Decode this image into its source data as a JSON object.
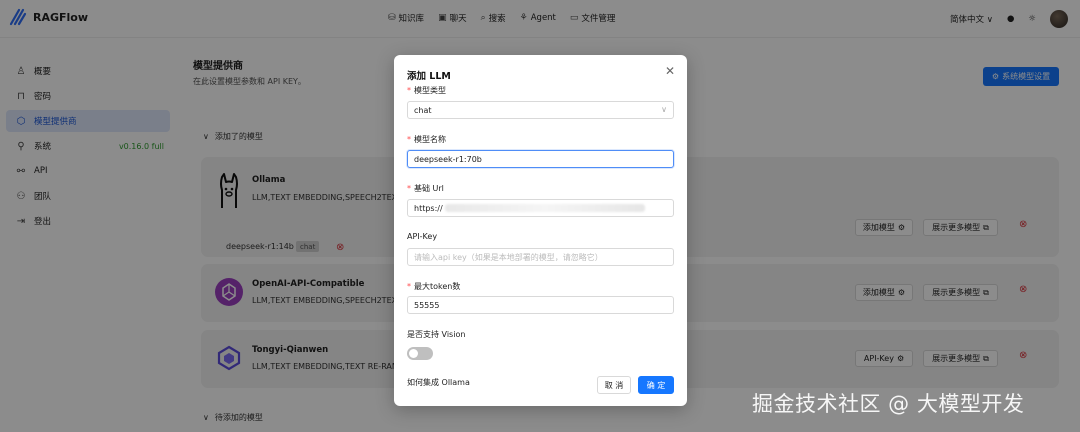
{
  "header": {
    "app_name": "RAGFlow",
    "nav": [
      {
        "icon": "database-icon",
        "label": "知识库"
      },
      {
        "icon": "chat-icon",
        "label": "聊天"
      },
      {
        "icon": "search-icon",
        "label": "搜索"
      },
      {
        "icon": "agent-icon",
        "label": "Agent"
      },
      {
        "icon": "folder-icon",
        "label": "文件管理"
      }
    ],
    "language": "简体中文"
  },
  "sidebar": {
    "items": [
      {
        "icon": "user-icon",
        "label": "概要"
      },
      {
        "icon": "lock-icon",
        "label": "密码"
      },
      {
        "icon": "cube-icon",
        "label": "模型提供商",
        "active": true
      },
      {
        "icon": "system-icon",
        "label": "系统",
        "badge": "v0.16.0 full"
      },
      {
        "icon": "api-icon",
        "label": "API"
      },
      {
        "icon": "team-icon",
        "label": "团队"
      },
      {
        "icon": "logout-icon",
        "label": "登出"
      }
    ]
  },
  "main": {
    "title": "模型提供商",
    "subtitle": "在此设置模型参数和 API KEY。",
    "system_settings_button": "系统模型设置",
    "added_section": "添加了的模型",
    "pending_section": "待添加的模型",
    "cards": [
      {
        "name": "Ollama",
        "tags": "LLM,TEXT EMBEDDING,SPEECH2TEXT",
        "button": "添加模型",
        "more": "展示更多模型",
        "sub_model": "deepseek-r1:14b",
        "sub_tag": "chat"
      },
      {
        "name": "OpenAI-API-Compatible",
        "tags": "LLM,TEXT EMBEDDING,SPEECH2TEXT",
        "button": "添加模型",
        "more": "展示更多模型"
      },
      {
        "name": "Tongyi-Qianwen",
        "tags": "LLM,TEXT EMBEDDING,TEXT RE-RANK",
        "button": "API-Key",
        "more": "展示更多模型"
      }
    ]
  },
  "modal": {
    "title": "添加 LLM",
    "model_type": {
      "label": "模型类型",
      "value": "chat"
    },
    "model_name": {
      "label": "模型名称",
      "value": "deepseek-r1:70b"
    },
    "base_url": {
      "label": "基础 Url",
      "value": "https://"
    },
    "api_key": {
      "label": "API-Key",
      "placeholder": "请输入api key（如果是本地部署的模型，请忽略它）"
    },
    "max_tokens": {
      "label": "最大token数",
      "value": "55555"
    },
    "vision": {
      "label": "是否支持 Vision",
      "enabled": false
    },
    "help_link": "如何集成 Ollama",
    "cancel": "取 消",
    "ok": "确 定"
  },
  "watermark": "掘金技术社区 @ 大模型开发",
  "colors": {
    "primary": "#1677ff",
    "active_bg": "#dfe7fb",
    "danger": "#ff4d4f",
    "version": "#2e9b2e"
  }
}
